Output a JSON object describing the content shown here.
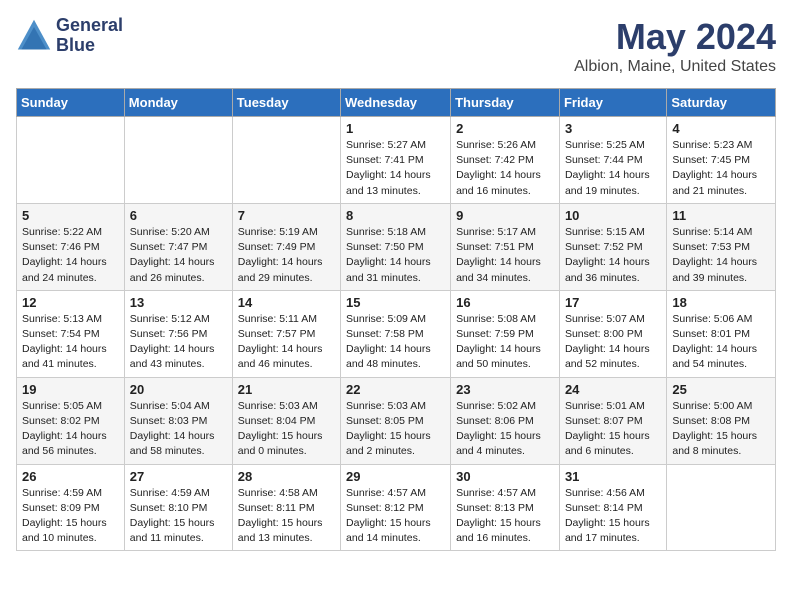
{
  "header": {
    "logo_line1": "General",
    "logo_line2": "Blue",
    "main_title": "May 2024",
    "subtitle": "Albion, Maine, United States"
  },
  "calendar": {
    "days_of_week": [
      "Sunday",
      "Monday",
      "Tuesday",
      "Wednesday",
      "Thursday",
      "Friday",
      "Saturday"
    ],
    "weeks": [
      [
        {
          "day": "",
          "info": ""
        },
        {
          "day": "",
          "info": ""
        },
        {
          "day": "",
          "info": ""
        },
        {
          "day": "1",
          "info": "Sunrise: 5:27 AM\nSunset: 7:41 PM\nDaylight: 14 hours\nand 13 minutes."
        },
        {
          "day": "2",
          "info": "Sunrise: 5:26 AM\nSunset: 7:42 PM\nDaylight: 14 hours\nand 16 minutes."
        },
        {
          "day": "3",
          "info": "Sunrise: 5:25 AM\nSunset: 7:44 PM\nDaylight: 14 hours\nand 19 minutes."
        },
        {
          "day": "4",
          "info": "Sunrise: 5:23 AM\nSunset: 7:45 PM\nDaylight: 14 hours\nand 21 minutes."
        }
      ],
      [
        {
          "day": "5",
          "info": "Sunrise: 5:22 AM\nSunset: 7:46 PM\nDaylight: 14 hours\nand 24 minutes."
        },
        {
          "day": "6",
          "info": "Sunrise: 5:20 AM\nSunset: 7:47 PM\nDaylight: 14 hours\nand 26 minutes."
        },
        {
          "day": "7",
          "info": "Sunrise: 5:19 AM\nSunset: 7:49 PM\nDaylight: 14 hours\nand 29 minutes."
        },
        {
          "day": "8",
          "info": "Sunrise: 5:18 AM\nSunset: 7:50 PM\nDaylight: 14 hours\nand 31 minutes."
        },
        {
          "day": "9",
          "info": "Sunrise: 5:17 AM\nSunset: 7:51 PM\nDaylight: 14 hours\nand 34 minutes."
        },
        {
          "day": "10",
          "info": "Sunrise: 5:15 AM\nSunset: 7:52 PM\nDaylight: 14 hours\nand 36 minutes."
        },
        {
          "day": "11",
          "info": "Sunrise: 5:14 AM\nSunset: 7:53 PM\nDaylight: 14 hours\nand 39 minutes."
        }
      ],
      [
        {
          "day": "12",
          "info": "Sunrise: 5:13 AM\nSunset: 7:54 PM\nDaylight: 14 hours\nand 41 minutes."
        },
        {
          "day": "13",
          "info": "Sunrise: 5:12 AM\nSunset: 7:56 PM\nDaylight: 14 hours\nand 43 minutes."
        },
        {
          "day": "14",
          "info": "Sunrise: 5:11 AM\nSunset: 7:57 PM\nDaylight: 14 hours\nand 46 minutes."
        },
        {
          "day": "15",
          "info": "Sunrise: 5:09 AM\nSunset: 7:58 PM\nDaylight: 14 hours\nand 48 minutes."
        },
        {
          "day": "16",
          "info": "Sunrise: 5:08 AM\nSunset: 7:59 PM\nDaylight: 14 hours\nand 50 minutes."
        },
        {
          "day": "17",
          "info": "Sunrise: 5:07 AM\nSunset: 8:00 PM\nDaylight: 14 hours\nand 52 minutes."
        },
        {
          "day": "18",
          "info": "Sunrise: 5:06 AM\nSunset: 8:01 PM\nDaylight: 14 hours\nand 54 minutes."
        }
      ],
      [
        {
          "day": "19",
          "info": "Sunrise: 5:05 AM\nSunset: 8:02 PM\nDaylight: 14 hours\nand 56 minutes."
        },
        {
          "day": "20",
          "info": "Sunrise: 5:04 AM\nSunset: 8:03 PM\nDaylight: 14 hours\nand 58 minutes."
        },
        {
          "day": "21",
          "info": "Sunrise: 5:03 AM\nSunset: 8:04 PM\nDaylight: 15 hours\nand 0 minutes."
        },
        {
          "day": "22",
          "info": "Sunrise: 5:03 AM\nSunset: 8:05 PM\nDaylight: 15 hours\nand 2 minutes."
        },
        {
          "day": "23",
          "info": "Sunrise: 5:02 AM\nSunset: 8:06 PM\nDaylight: 15 hours\nand 4 minutes."
        },
        {
          "day": "24",
          "info": "Sunrise: 5:01 AM\nSunset: 8:07 PM\nDaylight: 15 hours\nand 6 minutes."
        },
        {
          "day": "25",
          "info": "Sunrise: 5:00 AM\nSunset: 8:08 PM\nDaylight: 15 hours\nand 8 minutes."
        }
      ],
      [
        {
          "day": "26",
          "info": "Sunrise: 4:59 AM\nSunset: 8:09 PM\nDaylight: 15 hours\nand 10 minutes."
        },
        {
          "day": "27",
          "info": "Sunrise: 4:59 AM\nSunset: 8:10 PM\nDaylight: 15 hours\nand 11 minutes."
        },
        {
          "day": "28",
          "info": "Sunrise: 4:58 AM\nSunset: 8:11 PM\nDaylight: 15 hours\nand 13 minutes."
        },
        {
          "day": "29",
          "info": "Sunrise: 4:57 AM\nSunset: 8:12 PM\nDaylight: 15 hours\nand 14 minutes."
        },
        {
          "day": "30",
          "info": "Sunrise: 4:57 AM\nSunset: 8:13 PM\nDaylight: 15 hours\nand 16 minutes."
        },
        {
          "day": "31",
          "info": "Sunrise: 4:56 AM\nSunset: 8:14 PM\nDaylight: 15 hours\nand 17 minutes."
        },
        {
          "day": "",
          "info": ""
        }
      ]
    ]
  }
}
